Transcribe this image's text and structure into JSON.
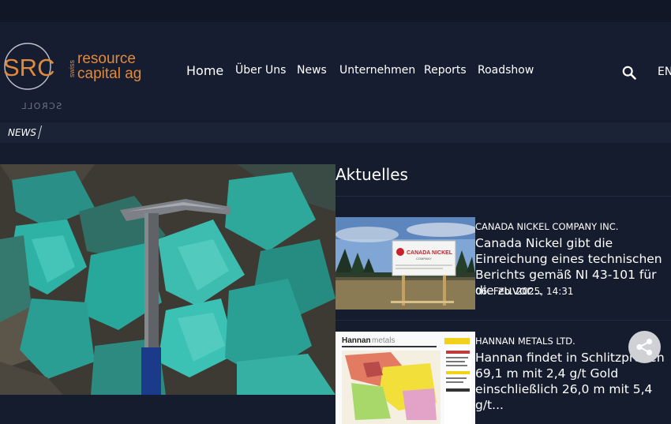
{
  "brand": {
    "logo_initials": "SRC",
    "logo_swiss": "swiss",
    "logo_line1": "resource",
    "logo_line2": "capital ag",
    "scroll_label": "SCROLL"
  },
  "nav": {
    "items": [
      {
        "label": "Home",
        "active": true
      },
      {
        "label": "Über Uns"
      },
      {
        "label": "News"
      },
      {
        "label": "Unternehmen"
      },
      {
        "label": "Reports"
      },
      {
        "label": "Roadshow"
      }
    ],
    "search_icon": "search-icon",
    "language": "EN"
  },
  "breadcrumb": {
    "current": "NEWS"
  },
  "aside": {
    "title": "Aktuelles",
    "items": [
      {
        "company": "CANADA NICKEL COMPANY INC.",
        "headline": "Canada Nickel gibt die Einreichung eines technischen Berichts gemäß NI 43-101 für die zuvor...",
        "date": "06. Feb. 2025, 14:31",
        "sign_title": "CANADA NICKEL",
        "sign_subtitle": "COMPANY"
      },
      {
        "company": "HANNAN METALS LTD.",
        "headline": "Hannan findet in Schlitzproben 69,1 m mit 2,4 g/t Gold einschließlich 26,0 m mit 5,4 g/t...",
        "date": "",
        "logo_text": "Hannan",
        "logo_suffix": "metals"
      }
    ]
  },
  "colors": {
    "accent": "#e08a3c",
    "background": "#151c2e",
    "header": "#161d30"
  },
  "share": {
    "icon": "share-icon"
  }
}
